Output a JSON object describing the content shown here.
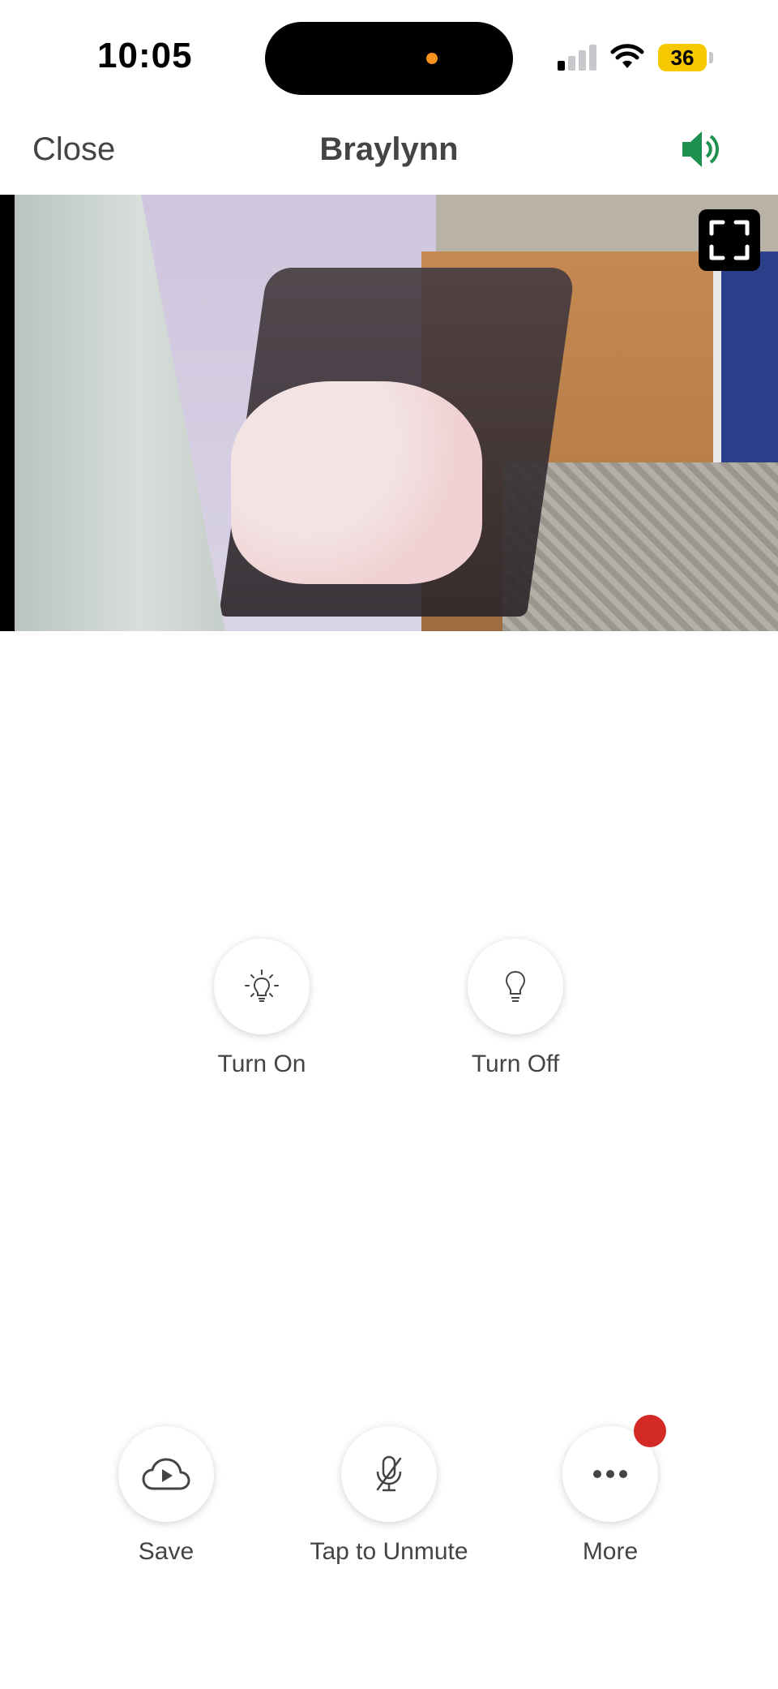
{
  "status_bar": {
    "time": "10:05",
    "battery": "36",
    "signal_bars_active": 1
  },
  "nav": {
    "close_label": "Close",
    "title": "Braylynn",
    "speaker_color": "#1e9150"
  },
  "controls": {
    "turn_on_label": "Turn On",
    "turn_off_label": "Turn Off"
  },
  "toolbar": {
    "save_label": "Save",
    "unmute_label": "Tap to Unmute",
    "more_label": "More"
  },
  "colors": {
    "badge": "#d32a26",
    "battery": "#f5c800"
  }
}
